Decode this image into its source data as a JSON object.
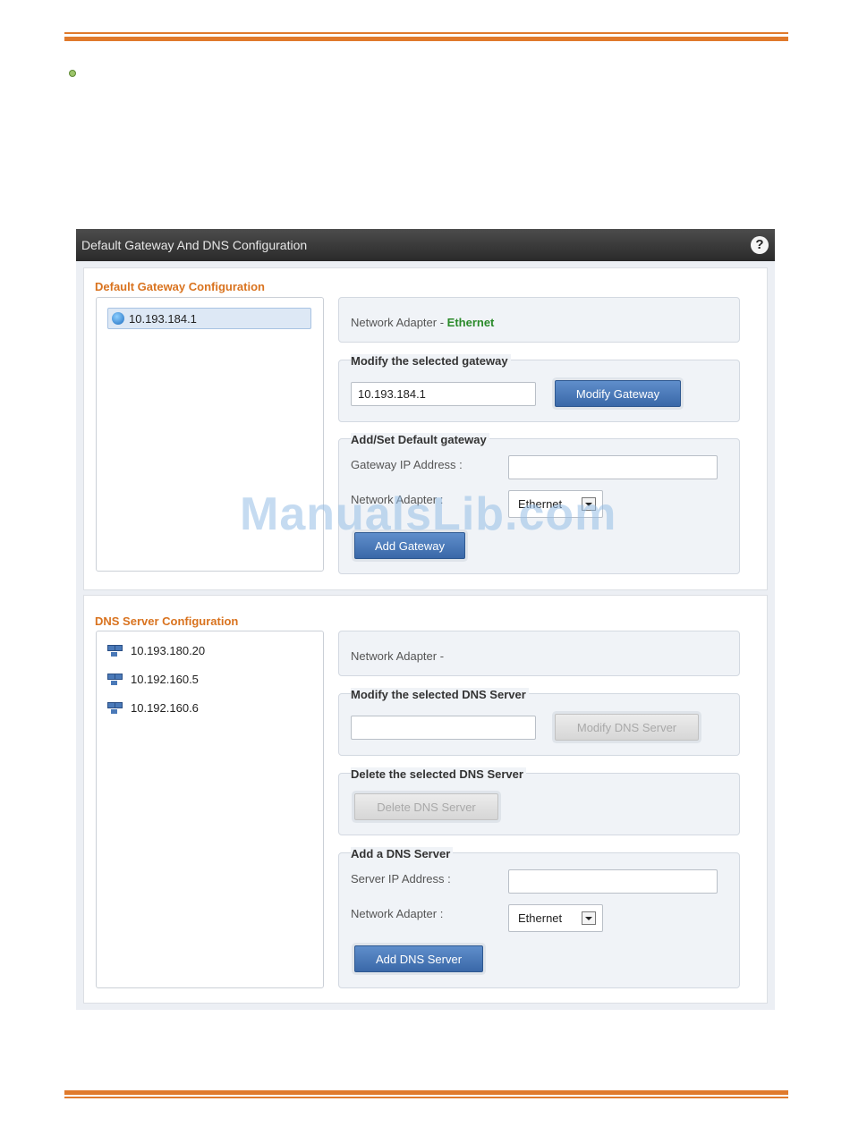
{
  "window": {
    "title": "Default Gateway And DNS Configuration",
    "help_icon": "?"
  },
  "gateway": {
    "section_title": "Default Gateway Configuration",
    "items": [
      "10.193.184.1"
    ],
    "adapter_label": "Network Adapter - ",
    "adapter_value": "Ethernet",
    "modify": {
      "title": "Modify the selected gateway",
      "value": "10.193.184.1",
      "button": "Modify Gateway"
    },
    "add": {
      "title": "Add/Set Default gateway",
      "ip_label": "Gateway IP Address :",
      "ip_value": "",
      "adapter_label": "Network Adapter :",
      "adapter_selected": "Ethernet",
      "button": "Add Gateway"
    }
  },
  "dns": {
    "section_title": "DNS Server Configuration",
    "items": [
      "10.193.180.20",
      "10.192.160.5",
      "10.192.160.6"
    ],
    "adapter_label": "Network Adapter - ",
    "modify": {
      "title": "Modify the selected DNS Server",
      "value": "",
      "button": "Modify DNS Server"
    },
    "delete": {
      "title": "Delete the selected DNS Server",
      "button": "Delete DNS Server"
    },
    "add": {
      "title": "Add a DNS Server",
      "ip_label": "Server IP Address :",
      "ip_value": "",
      "adapter_label": "Network Adapter :",
      "adapter_selected": "Ethernet",
      "button": "Add DNS Server"
    }
  },
  "watermark": "ManualsLib.com",
  "colors": {
    "accent_orange": "#e07a2c",
    "section_title": "#d9731f",
    "adapter_green": "#2a8a2a",
    "button_blue": "#3a68a8"
  }
}
